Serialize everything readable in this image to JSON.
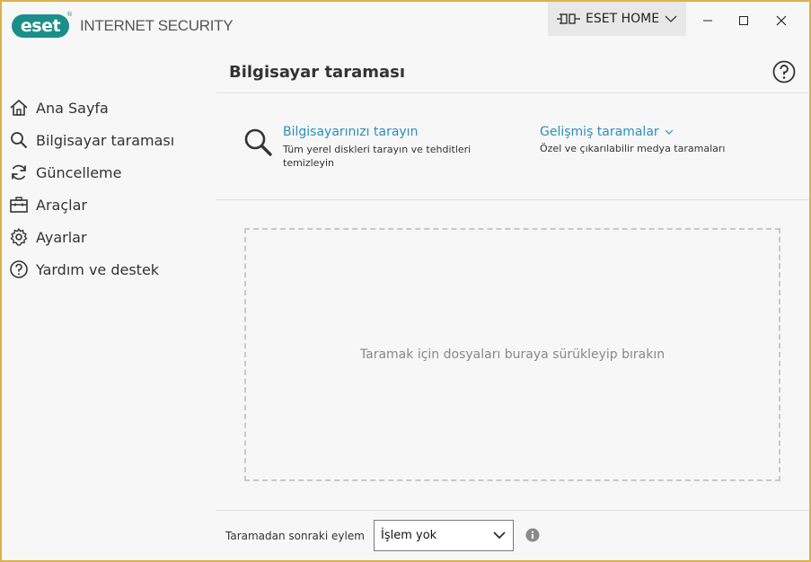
{
  "app": {
    "logo_text": "eset",
    "logo_reg": "®",
    "product_name": "INTERNET SECURITY",
    "home_button_label": "ESET HOME"
  },
  "window_controls": {
    "minimize_icon": "minimize-icon",
    "maximize_icon": "maximize-icon",
    "close_icon": "close-icon"
  },
  "sidebar": {
    "items": [
      {
        "label": "Ana Sayfa",
        "icon": "home-icon"
      },
      {
        "label": "Bilgisayar taraması",
        "icon": "search-icon"
      },
      {
        "label": "Güncelleme",
        "icon": "refresh-icon"
      },
      {
        "label": "Araçlar",
        "icon": "toolbox-icon"
      },
      {
        "label": "Ayarlar",
        "icon": "gear-icon"
      },
      {
        "label": "Yardım ve destek",
        "icon": "help-icon"
      }
    ]
  },
  "main": {
    "title": "Bilgisayar taraması",
    "scan_computer": {
      "label": "Bilgisayarınızı tarayın",
      "description": "Tüm yerel diskleri tarayın ve tehditleri temizleyin"
    },
    "advanced_scans": {
      "label": "Gelişmiş taramalar",
      "description": "Özel ve çıkarılabilir medya taramaları"
    },
    "drop_zone_text": "Taramak için dosyaları buraya sürükleyip bırakın",
    "after_scan": {
      "label": "Taramadan sonraki eylem",
      "selected": "İşlem yok"
    }
  },
  "colors": {
    "brand": "#1a8f8a",
    "link": "#2a8fbd",
    "window_border": "#d9b34a"
  }
}
